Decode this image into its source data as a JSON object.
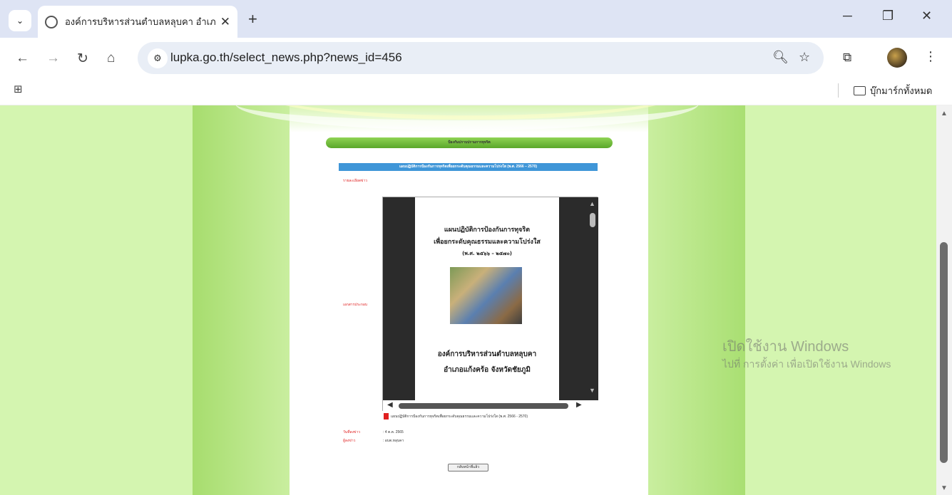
{
  "browser": {
    "tab_title": "องค์การบริหารส่วนตำบลหลุบคา อำเภ",
    "url": "lupka.go.th/select_news.php?news_id=456",
    "bookmarks_all_label": "บุ๊กมาร์กทั้งหมด",
    "icons": {
      "tab_search": "chevron-down-icon",
      "globe": "globe-icon",
      "close_tab": "close-icon",
      "new_tab": "plus-icon",
      "back": "back-arrow-icon",
      "forward": "forward-arrow-icon",
      "reload": "reload-icon",
      "home": "home-icon",
      "site_info": "tune-icon",
      "zoom": "zoom-icon",
      "star": "star-icon",
      "extensions": "puzzle-icon",
      "menu": "kebab-menu-icon",
      "apps": "apps-grid-icon",
      "folder": "folder-icon"
    }
  },
  "page": {
    "section_header": "ป้องกันปราบปรามการทุจริต",
    "news_title": "แผนปฏิบัติการป้องกันการทุจริตเพื่อยกระดับคุณธรรมและความโปร่งใส (พ.ศ. 2566 – 2570)",
    "details_label": "รายละเอียดข่าว",
    "attachment_label": "เอกสารประกอบ",
    "pdf": {
      "line1": "แผนปฏิบัติการป้องกันการทุจริต",
      "line2": "เพื่อยกระดับคุณธรรมและความโปร่งใส",
      "line3": "(พ.ศ. ๒๕๖๖ – ๒๕๗๐)",
      "line4": "องค์การบริหารส่วนตำบลหลุบคา",
      "line5": "อำเภอแก้งคร้อ จังหวัดชัยภูมิ"
    },
    "file_link": "แผนปฏิบัติการป้องกันการทุจริตเพื่อยกระดับคุณธรรมและความโปร่งใส (พ.ศ. 2566 - 2570)",
    "date_label": "วันที่ลงข่าว",
    "date_value": ": 4 ต.ค. 2565",
    "author_label": "ผู้ลงข่าว",
    "author_value": ": อบต.หลุบคา",
    "back_button": "กลับหน้าที่แล้ว"
  },
  "watermark": {
    "line1": "เปิดใช้งาน Windows",
    "line2": "ไปที่ การตั้งค่า เพื่อเปิดใช้งาน Windows"
  }
}
